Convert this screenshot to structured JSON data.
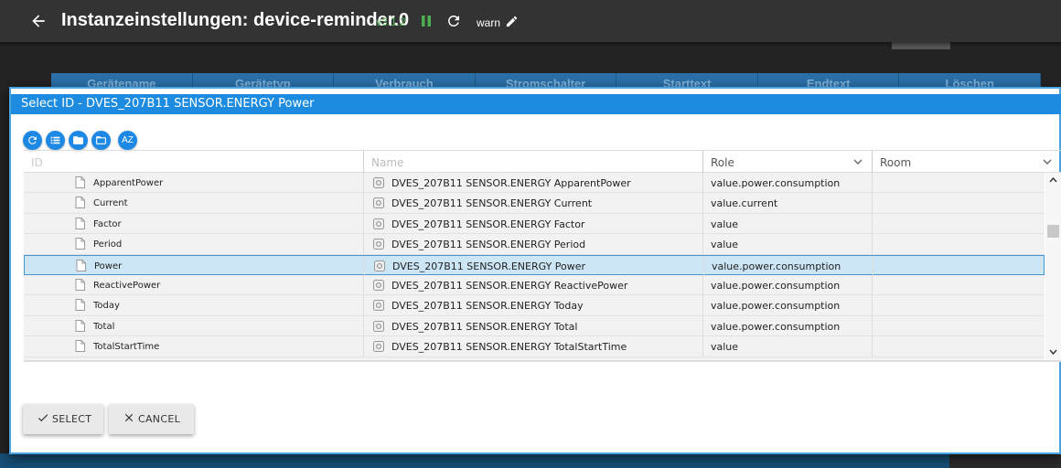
{
  "header": {
    "title": "Instanzeinstellungen: device-reminder.0",
    "version": "v3.1.2",
    "loglevel": "warn"
  },
  "background": {
    "columns": [
      "Gerätename",
      "Gerätetyp",
      "Verbrauch",
      "Stromschalter",
      "Starttext",
      "Endtext",
      "Löschen"
    ]
  },
  "dialog": {
    "title": "Select ID - DVES_207B11 SENSOR.ENERGY Power",
    "toolbar": {
      "az_label": "AZ"
    },
    "columns": {
      "id": "ID",
      "name": "Name",
      "role": "Role",
      "room": "Room"
    },
    "rows": [
      {
        "id": "ApparentPower",
        "name": "DVES_207B11 SENSOR.ENERGY ApparentPower",
        "role": "value.power.consumption",
        "room": ""
      },
      {
        "id": "Current",
        "name": "DVES_207B11 SENSOR.ENERGY Current",
        "role": "value.current",
        "room": ""
      },
      {
        "id": "Factor",
        "name": "DVES_207B11 SENSOR.ENERGY Factor",
        "role": "value",
        "room": ""
      },
      {
        "id": "Period",
        "name": "DVES_207B11 SENSOR.ENERGY Period",
        "role": "value",
        "room": ""
      },
      {
        "id": "Power",
        "name": "DVES_207B11 SENSOR.ENERGY Power",
        "role": "value.power.consumption",
        "room": "",
        "selected": true
      },
      {
        "id": "ReactivePower",
        "name": "DVES_207B11 SENSOR.ENERGY ReactivePower",
        "role": "value.power.consumption",
        "room": ""
      },
      {
        "id": "Today",
        "name": "DVES_207B11 SENSOR.ENERGY Today",
        "role": "value.power.consumption",
        "room": ""
      },
      {
        "id": "Total",
        "name": "DVES_207B11 SENSOR.ENERGY Total",
        "role": "value.power.consumption",
        "room": ""
      },
      {
        "id": "TotalStartTime",
        "name": "DVES_207B11 SENSOR.ENERGY TotalStartTime",
        "role": "value",
        "room": ""
      }
    ],
    "buttons": {
      "select": "SELECT",
      "cancel": "CANCEL"
    }
  },
  "colors": {
    "accent": "#1d8ce0",
    "header_bg": "#333333",
    "version": "#4caf50",
    "selected_row": "#cde6f6"
  }
}
